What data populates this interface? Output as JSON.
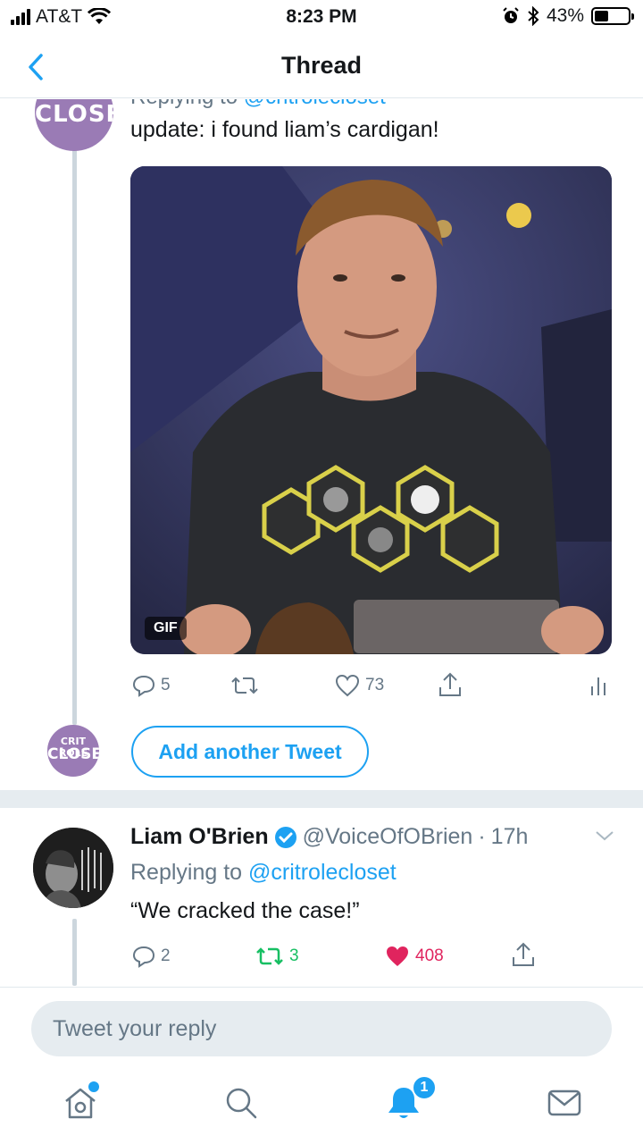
{
  "status_bar": {
    "carrier": "AT&T",
    "time": "8:23 PM",
    "battery": "43%",
    "battery_level": 0.43,
    "icons": [
      "signal-icon",
      "wifi-icon",
      "alarm-icon",
      "bluetooth-icon",
      "battery-icon"
    ]
  },
  "nav": {
    "title": "Thread",
    "back_icon": "chevron-left-icon"
  },
  "tweet1": {
    "avatar_text": "CLOSET",
    "replying_label": "Replying to",
    "replying_handle": "@critrolecloset",
    "text": "update: i found liam’s cardigan!",
    "media_badge": "GIF",
    "replies": "5",
    "likes": "73"
  },
  "add_tweet": {
    "avatar_line1": "CRIT ROLE",
    "avatar_line2": "CLOSET",
    "button_label": "Add another Tweet"
  },
  "tweet2": {
    "name": "Liam O'Brien",
    "handle": "@VoiceOfOBrien",
    "separator": "·",
    "time": "17h",
    "replying_label": "Replying to",
    "replying_handle": "@critrolecloset",
    "text": "“We cracked the case!”",
    "replies": "2",
    "retweets": "3",
    "likes": "408"
  },
  "reply_bar": {
    "placeholder": "Tweet your reply"
  },
  "tab_bar": {
    "notification_count": "1",
    "tabs": [
      "home-icon",
      "search-icon",
      "notifications-icon",
      "messages-icon"
    ]
  },
  "colors": {
    "accent": "#1da1f2",
    "retweet_green": "#17bf63",
    "like_red": "#e0245e",
    "secondary_text": "#657786"
  }
}
